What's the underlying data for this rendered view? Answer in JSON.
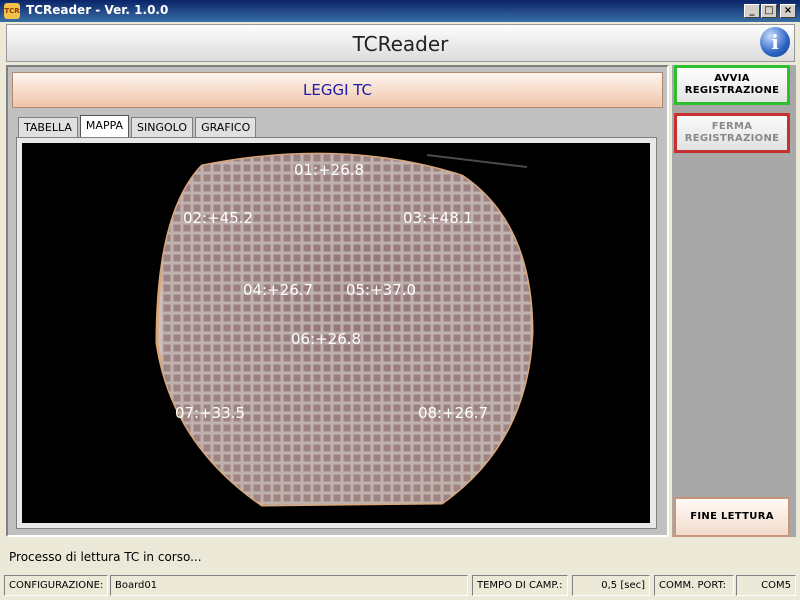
{
  "window": {
    "title": "TCReader - Ver. 1.0.0",
    "icon": "TCR"
  },
  "header": {
    "title": "TCReader"
  },
  "section": {
    "title": "LEGGI TC"
  },
  "tabs": [
    {
      "label": "TABELLA",
      "active": false
    },
    {
      "label": "MAPPA",
      "active": true
    },
    {
      "label": "SINGOLO",
      "active": false
    },
    {
      "label": "GRAFICO",
      "active": false
    }
  ],
  "map": {
    "labels": [
      {
        "id": "01",
        "text": "01:+26.8"
      },
      {
        "id": "02",
        "text": "02:+45.2"
      },
      {
        "id": "03",
        "text": "03:+48.1"
      },
      {
        "id": "04",
        "text": "04:+26.7"
      },
      {
        "id": "05",
        "text": "05:+37.0"
      },
      {
        "id": "06",
        "text": "06:+26.8"
      },
      {
        "id": "07",
        "text": "07:+33.5"
      },
      {
        "id": "08",
        "text": "08:+26.7"
      }
    ]
  },
  "sidebar": {
    "start_line1": "AVVIA",
    "start_line2": "REGISTRAZIONE",
    "stop_line1": "FERMA",
    "stop_line2": "REGISTRAZIONE",
    "end_label": "FINE LETTURA"
  },
  "status": {
    "message": "Processo di lettura TC in corso..."
  },
  "statusbar": {
    "config_label": "CONFIGURAZIONE:",
    "config_value": "Board01",
    "sampling_label": "TEMPO DI CAMP.:",
    "sampling_value": "0,5 [sec]",
    "port_label": "COMM. PORT:",
    "port_value": "COM5"
  },
  "colors": {
    "title_accent": "#1a1aa8",
    "start_border": "#2dbf2d",
    "stop_border": "#c63030"
  }
}
